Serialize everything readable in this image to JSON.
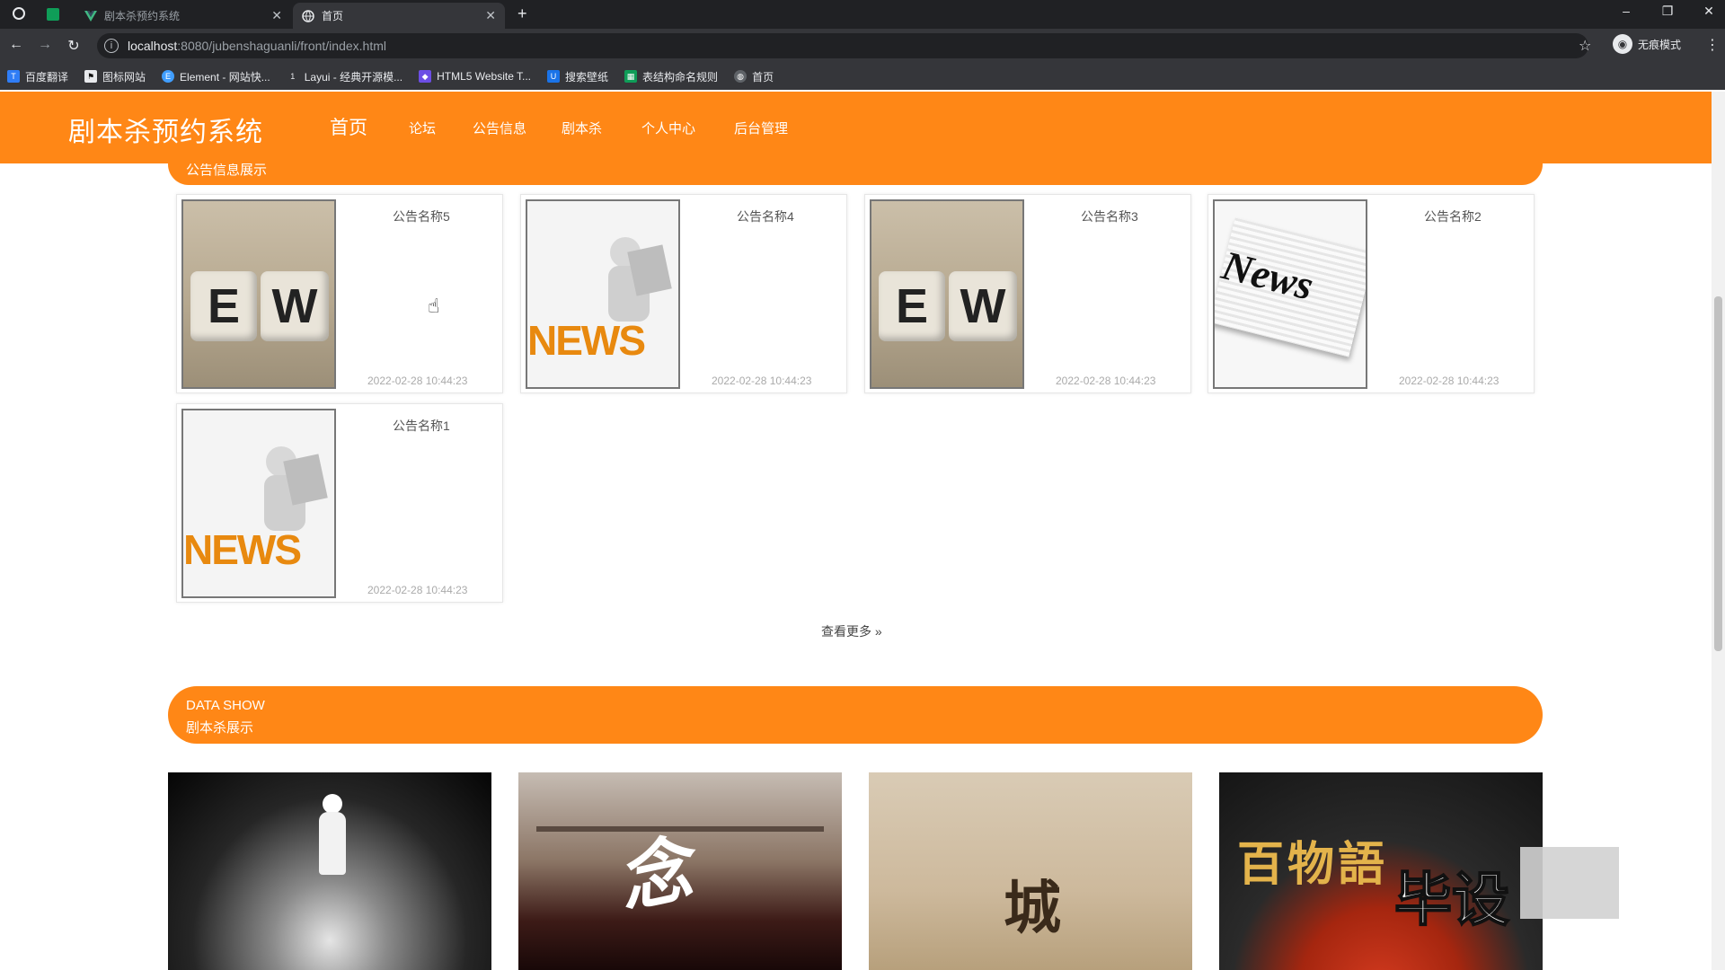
{
  "browser": {
    "tabs": [
      {
        "label": "剧本杀预约系统",
        "active": false
      },
      {
        "label": "首页",
        "active": true
      }
    ],
    "url_host": "localhost",
    "url_rest": ":8080/jubenshaguanli/front/index.html",
    "profile_label": "无痕模式",
    "bookmarks": [
      {
        "label": "百度翻译",
        "color": "#2f7df6"
      },
      {
        "label": "图标网站",
        "color": "#1a1a1a"
      },
      {
        "label": "Element - 网站快...",
        "color": "#409eff"
      },
      {
        "label": "Layui - 经典开源模...",
        "color": "#5fb878"
      },
      {
        "label": "HTML5 Website T...",
        "color": "#6c4ee5"
      },
      {
        "label": "搜索壁纸",
        "color": "#1a73e8"
      },
      {
        "label": "表结构命名规则",
        "color": "#0f9d58"
      },
      {
        "label": "首页",
        "color": "#5f6368"
      }
    ]
  },
  "site": {
    "brand": "剧本杀预约系统",
    "nav": [
      "首页",
      "论坛",
      "公告信息",
      "剧本杀",
      "个人中心",
      "后台管理"
    ],
    "accent": "#ff8716"
  },
  "notice_section": {
    "header_partial": "公告信息展示",
    "cards": [
      {
        "title": "公告名称5",
        "date": "2022-02-28 10:44:23",
        "image": "ew-blocks"
      },
      {
        "title": "公告名称4",
        "date": "2022-02-28 10:44:23",
        "image": "news-figure"
      },
      {
        "title": "公告名称3",
        "date": "2022-02-28 10:44:23",
        "image": "ew-blocks"
      },
      {
        "title": "公告名称2",
        "date": "2022-02-28 10:44:23",
        "image": "newspaper"
      },
      {
        "title": "公告名称1",
        "date": "2022-02-28 10:44:23",
        "image": "news-figure"
      }
    ],
    "more_label": "查看更多",
    "more_icon": "double-chevron-right-icon"
  },
  "script_section": {
    "header_en": "DATA SHOW",
    "header_cn": "剧本杀展示",
    "posters": [
      "dark-path",
      "yi-nian",
      "sepia-poster",
      "bai-wu-yu"
    ]
  },
  "watermark": {
    "text": "毕设"
  }
}
